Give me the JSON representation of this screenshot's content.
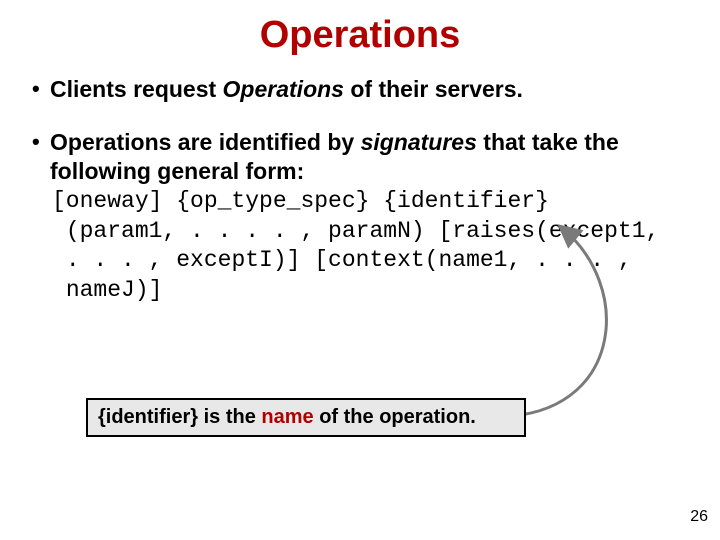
{
  "title": "Operations",
  "bullet1": {
    "pre": "Clients request ",
    "op": "Operations",
    "post": " of their servers."
  },
  "bullet2": {
    "pre": "Operations are identified by ",
    "sig": "signatures",
    "post": " that take the following general form:"
  },
  "code": "[oneway] {op_type_spec} {identifier}\n (param1, . . . . , paramN) [raises(except1,\n . . . , exceptI)] [context(name1, . . . ,\n nameJ)]",
  "callout": {
    "ident": "{identifier}",
    "mid": " is the ",
    "name": "name",
    "post": " of the operation."
  },
  "pagenum": "26"
}
